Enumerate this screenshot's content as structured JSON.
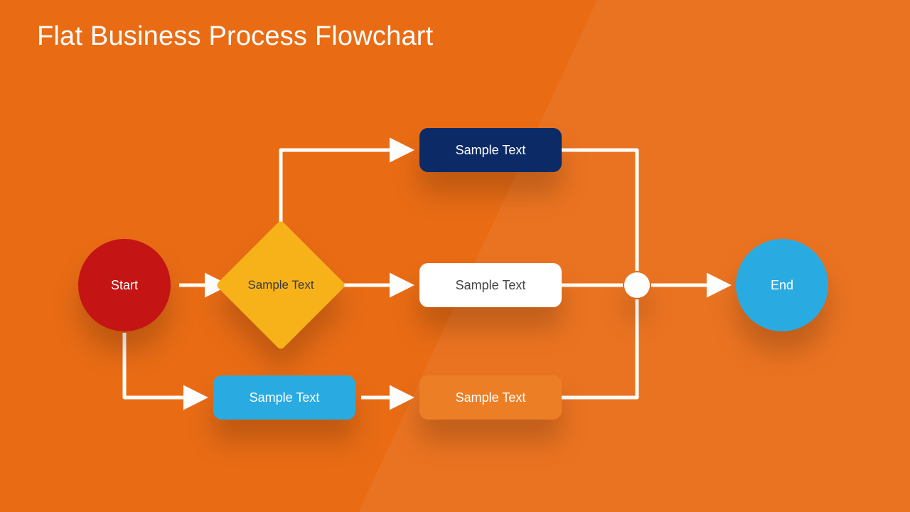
{
  "title": "Flat Business Process Flowchart",
  "nodes": {
    "start": "Start",
    "decision": "Sample Text",
    "process_top": "Sample Text",
    "process_mid": "Sample Text",
    "process_bottom": "Sample Text",
    "process_alt": "Sample Text",
    "end": "End"
  },
  "colors": {
    "background": "#e96c15",
    "start": "#c41414",
    "decision": "#f7b21a",
    "process_top": "#0b2a66",
    "process_mid": "#ffffff",
    "process_bottom": "#ec7f26",
    "process_alt": "#29abe2",
    "end": "#29abe2",
    "connector": "#ffffff"
  }
}
